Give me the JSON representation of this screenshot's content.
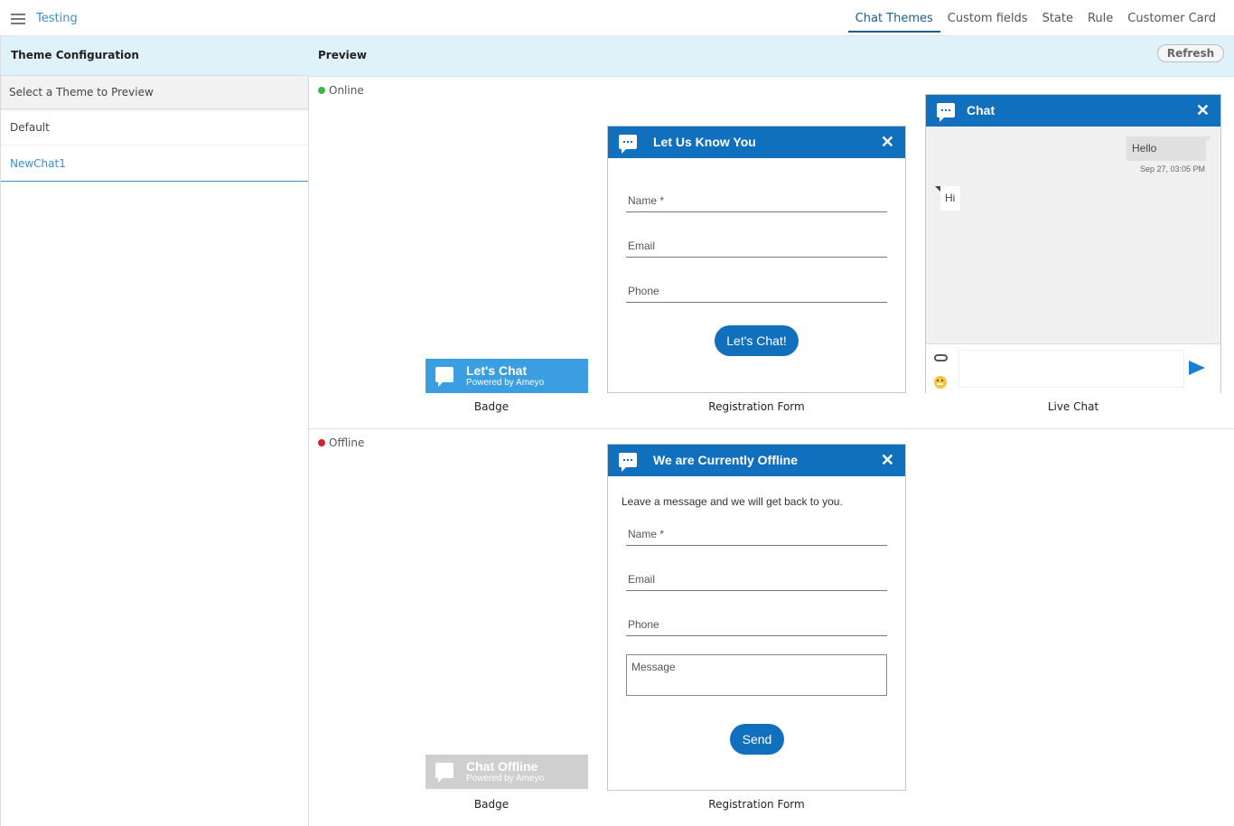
{
  "app": {
    "title": "Testing"
  },
  "nav": {
    "tabs": [
      "Chat Themes",
      "Custom fields",
      "State",
      "Rule",
      "Customer Card"
    ]
  },
  "left": {
    "header": "Theme Configuration",
    "select_label": "Select a Theme to Preview",
    "themes": [
      "Default",
      "NewChat1"
    ]
  },
  "preview": {
    "header": "Preview",
    "refresh": "Refresh",
    "online": {
      "status": "Online",
      "status_color": "#3cb84a",
      "badge": {
        "title": "Let's Chat",
        "sub": "Powered by Ameyo",
        "caption": "Badge"
      },
      "form": {
        "title": "Let Us Know You",
        "fields": [
          "Name *",
          "Email",
          "Phone"
        ],
        "button": "Let's Chat!",
        "caption": "Registration Form"
      },
      "chat": {
        "title": "Chat",
        "out_msg": "Hello",
        "out_time": "Sep 27, 03:05 PM",
        "in_msg": "Hi",
        "caption": "Live Chat"
      }
    },
    "offline": {
      "status": "Offline",
      "status_color": "#d32030",
      "badge": {
        "title": "Chat Offline",
        "sub": "Powered by Ameyo",
        "caption": "Badge"
      },
      "form": {
        "title": "We are Currently Offline",
        "message": "Leave a message and we will get back to you.",
        "fields": [
          "Name *",
          "Email",
          "Phone"
        ],
        "textarea": "Message",
        "button": "Send",
        "caption": "Registration Form"
      }
    }
  },
  "colors": {
    "accent": "#1170bd",
    "header_bg": "#dff2fa",
    "badge_online": "#3a9ee0",
    "badge_offline": "#cfcfcf"
  }
}
